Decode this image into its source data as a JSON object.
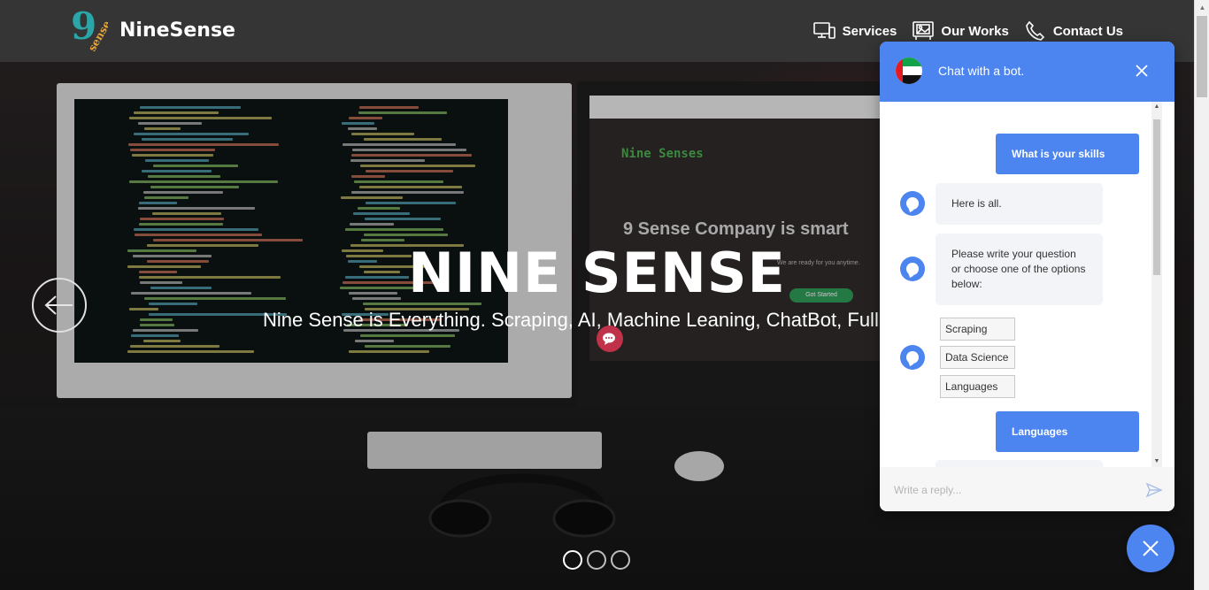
{
  "header": {
    "brand": "NineSense",
    "logo_text": "9 sense",
    "nav": [
      {
        "label": "Services",
        "icon": "monitor-icon"
      },
      {
        "label": "Our Works",
        "icon": "gallery-icon"
      },
      {
        "label": "Contact Us",
        "icon": "phone-icon"
      }
    ]
  },
  "hero": {
    "title": "NINE SENSE",
    "subtitle": "Nine Sense is Everything. Scraping, AI, Machine Leaning, ChatBot, Full S",
    "screen_brand": "Nine Senses",
    "screen_heading": "9 Sense Company is smart",
    "screen_sub": "We are ready for you anytime.",
    "screen_button": "Got Started",
    "slides": 3,
    "active_slide": 1
  },
  "chat": {
    "title": "Chat with a bot.",
    "messages": {
      "user1": "What is your skills",
      "bot1": "Here is all.",
      "bot2": "Please write your question or choose one of the options below:",
      "user2": "Languages"
    },
    "options": [
      "Scraping",
      "Data Science",
      "Languages"
    ],
    "input_placeholder": "Write a reply...",
    "accent": "#4c84f0"
  }
}
